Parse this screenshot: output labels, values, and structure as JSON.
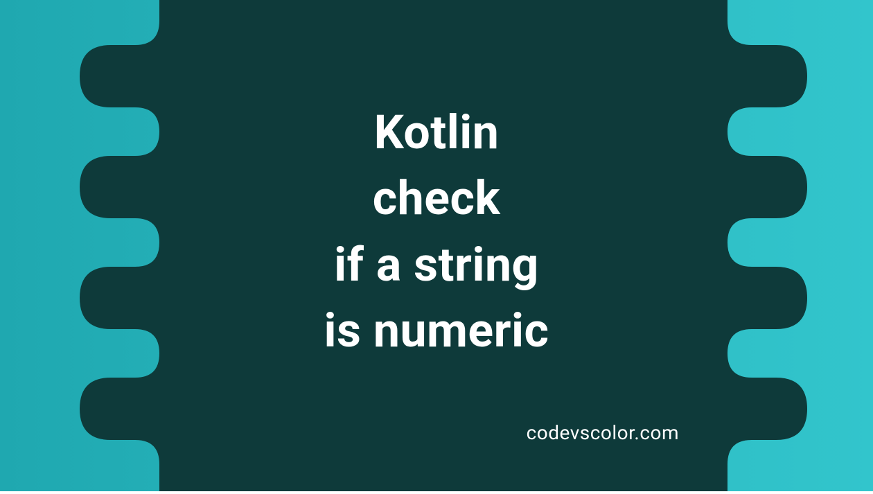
{
  "banner": {
    "title_line1": "Kotlin",
    "title_line2": "check",
    "title_line3": "if a string",
    "title_line4": "is numeric",
    "attribution": "codevscolor.com"
  },
  "colors": {
    "background_gradient_start": "#1fa8b0",
    "background_gradient_end": "#32c5cc",
    "blob": "#0e3a3a",
    "text": "#ffffff"
  }
}
